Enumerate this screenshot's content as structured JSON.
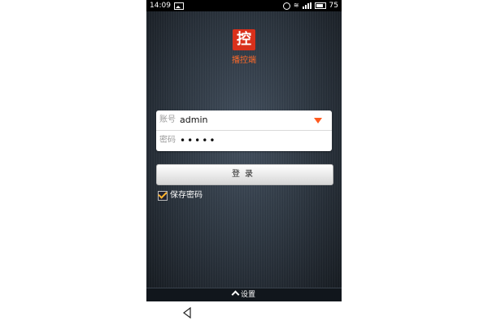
{
  "status_bar": {
    "time": "14:09",
    "battery": "75",
    "icons": [
      "picture-icon",
      "alarm-icon",
      "wifi-icon",
      "signal-icon",
      "battery-icon"
    ]
  },
  "app": {
    "logo_char": "控",
    "name": "播控端"
  },
  "login_form": {
    "account_label": "账号",
    "account_value": "admin",
    "password_label": "密码",
    "password_value": "•••••"
  },
  "login_button": {
    "label": "登录"
  },
  "remember_password": {
    "label": "保存密码",
    "checked": true
  },
  "settings_bar": {
    "label": "设置"
  },
  "colors": {
    "accent": "#ff5a1f",
    "logo_bg": "#d9301b",
    "check": "#ffb52e"
  }
}
